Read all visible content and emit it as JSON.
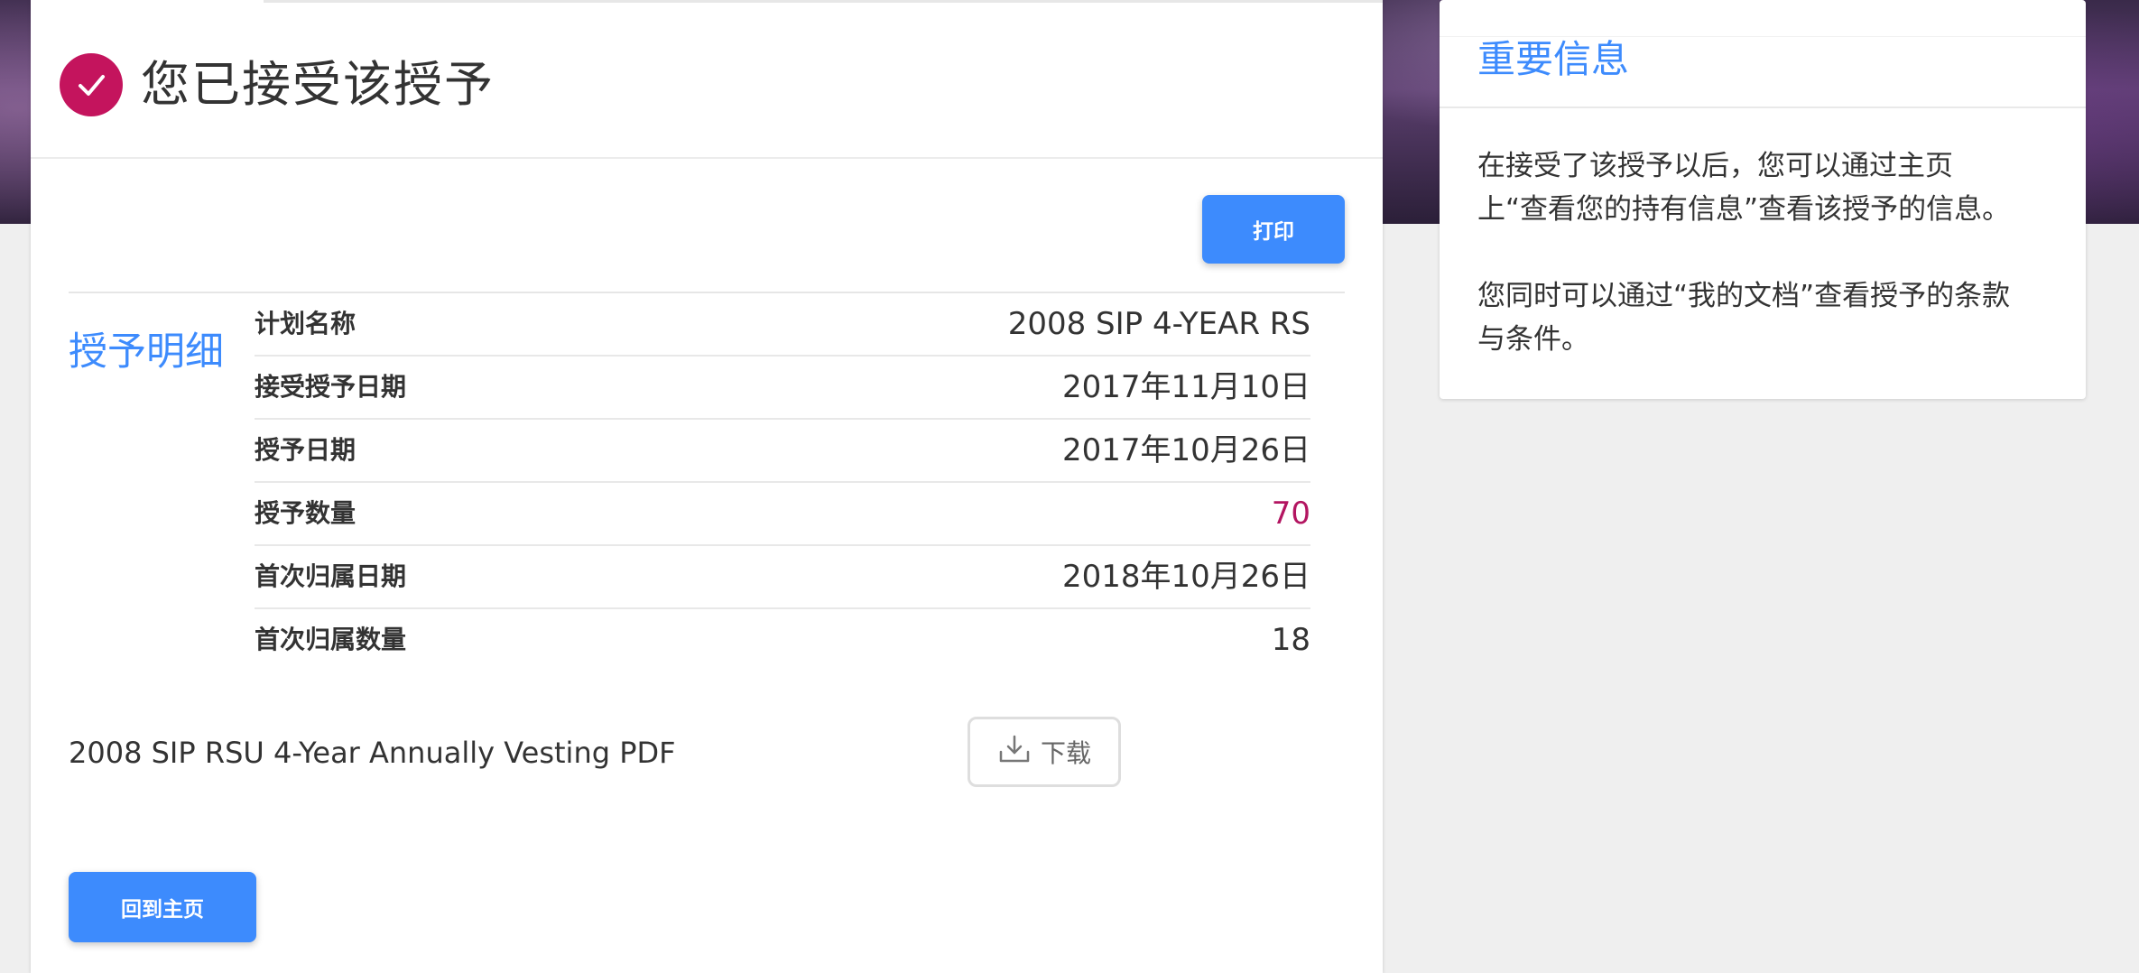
{
  "header": {
    "title": "您已接受该授予",
    "icon": "check-circle-icon",
    "accent_color": "#c4145d"
  },
  "actions": {
    "print_label": "打印",
    "download_label": "下载",
    "home_label": "回到主页"
  },
  "details": {
    "section_title": "授予明细",
    "rows": [
      {
        "label": "计划名称",
        "value": "2008 SIP 4-YEAR RS"
      },
      {
        "label": "接受授予日期",
        "value": "2017年11月10日"
      },
      {
        "label": "授予日期",
        "value": "2017年10月26日"
      },
      {
        "label": "授予数量",
        "value": "70"
      },
      {
        "label": "首次归属日期",
        "value": "2018年10月26日"
      },
      {
        "label": "首次归属数量",
        "value": "18"
      }
    ]
  },
  "document": {
    "name": "2008 SIP RSU 4-Year Annually Vesting PDF",
    "icon": "download-icon"
  },
  "info": {
    "title": "重要信息",
    "paragraph1_line1": "在接受了该授予以后，您可以通过主页",
    "paragraph1_line2": "上“查看您的持有信息”查看该授予的信息。",
    "paragraph2_line1": "您同时可以通过“我的文档”查看授予的条款",
    "paragraph2_line2": "与条件。"
  },
  "colors": {
    "primary": "#3d8bfd",
    "accent": "#b31561"
  }
}
